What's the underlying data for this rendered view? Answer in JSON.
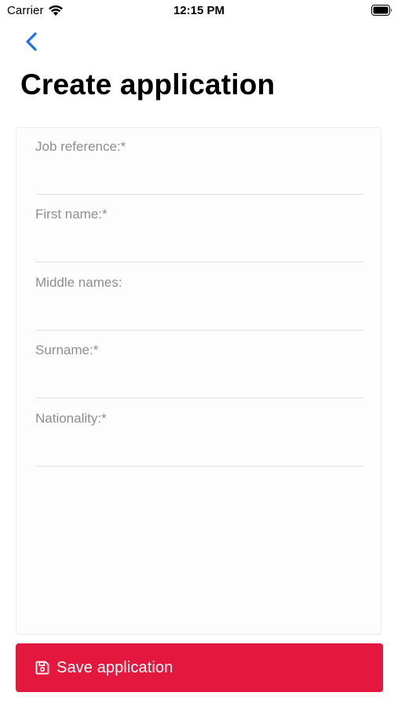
{
  "status_bar": {
    "carrier": "Carrier",
    "time": "12:15 PM"
  },
  "nav": {
    "back_icon": "chevron-left-icon"
  },
  "page": {
    "title": "Create application"
  },
  "form": {
    "fields": [
      {
        "label": "Job reference:*",
        "value": ""
      },
      {
        "label": "First name:*",
        "value": ""
      },
      {
        "label": "Middle names:",
        "value": ""
      },
      {
        "label": "Surname:*",
        "value": ""
      },
      {
        "label": "Nationality:*",
        "value": ""
      }
    ]
  },
  "actions": {
    "save_label": "Save application",
    "save_icon": "floppy-disk-icon"
  },
  "colors": {
    "accent": "#e4173e",
    "link": "#1a73e8",
    "label": "#8e8e8e"
  }
}
